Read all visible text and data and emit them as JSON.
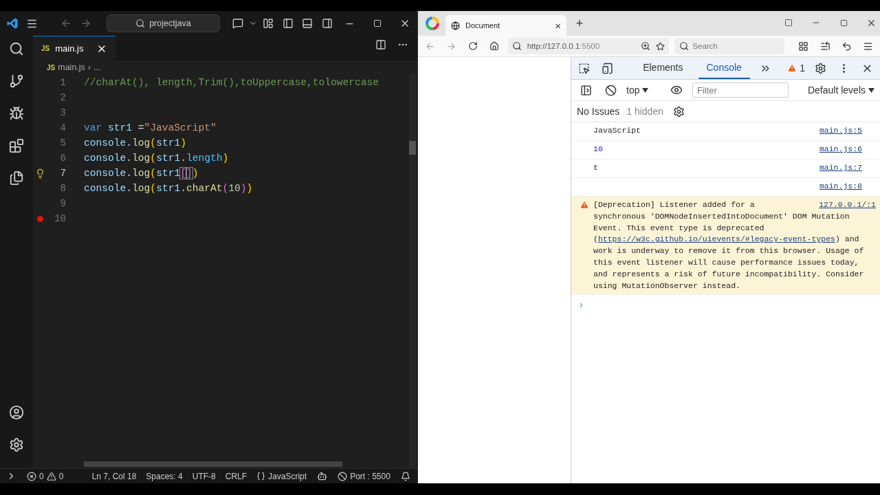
{
  "editor": {
    "command_center": "projectjava",
    "tabs": [
      {
        "label": "main.js",
        "icon": "JS",
        "selected": true
      }
    ],
    "breadcrumb": {
      "icon": "JS",
      "file": "main.js",
      "separator": "›",
      "rest": "..."
    },
    "lines": [
      {
        "number": "1",
        "current": false,
        "tokens": [
          {
            "kind": "comment",
            "text": "//charAt(), length,Trim(),toUppercase,tolowercase"
          }
        ]
      },
      {
        "number": "2",
        "current": false
      },
      {
        "number": "3",
        "current": false
      },
      {
        "number": "4",
        "current": false,
        "tokens": [
          {
            "kind": "keyword",
            "text": "var "
          },
          {
            "kind": "variable",
            "text": "str1"
          },
          {
            "kind": "plain",
            "text": " ="
          },
          {
            "kind": "string",
            "text": "\"JavaScript\""
          }
        ]
      },
      {
        "number": "5",
        "current": false,
        "tokens": [
          {
            "kind": "variable",
            "text": "console"
          },
          {
            "kind": "plain",
            "text": "."
          },
          {
            "kind": "function",
            "text": "log"
          },
          {
            "kind": "bracket",
            "text": "("
          },
          {
            "kind": "variable",
            "text": "str1"
          },
          {
            "kind": "bracket",
            "text": ")"
          }
        ]
      },
      {
        "number": "6",
        "current": false,
        "tokens": [
          {
            "kind": "variable",
            "text": "console"
          },
          {
            "kind": "plain",
            "text": "."
          },
          {
            "kind": "function",
            "text": "log"
          },
          {
            "kind": "bracket",
            "text": "("
          },
          {
            "kind": "variable",
            "text": "str1"
          },
          {
            "kind": "plain",
            "text": "."
          },
          {
            "kind": "property",
            "text": "length"
          },
          {
            "kind": "bracket",
            "text": ")"
          }
        ]
      },
      {
        "number": "7",
        "current": true,
        "lightbulb": true,
        "tokens": [
          {
            "kind": "variable",
            "text": "console"
          },
          {
            "kind": "plain",
            "text": "."
          },
          {
            "kind": "function",
            "text": "log"
          },
          {
            "kind": "bracket",
            "text": "("
          },
          {
            "kind": "variable",
            "text": "str1"
          },
          {
            "kind": "matched-bracket",
            "text": "["
          },
          {
            "kind": "matched-bracket",
            "text": "]"
          },
          {
            "kind": "bracket",
            "text": ")"
          }
        ]
      },
      {
        "number": "8",
        "current": false,
        "tokens": [
          {
            "kind": "variable",
            "text": "console"
          },
          {
            "kind": "plain",
            "text": "."
          },
          {
            "kind": "function",
            "text": "log"
          },
          {
            "kind": "bracket",
            "text": "("
          },
          {
            "kind": "variable",
            "text": "str1"
          },
          {
            "kind": "plain",
            "text": "."
          },
          {
            "kind": "function",
            "text": "charAt"
          },
          {
            "kind": "inner-bracket",
            "text": "("
          },
          {
            "kind": "number",
            "text": "10"
          },
          {
            "kind": "inner-bracket",
            "text": ")"
          },
          {
            "kind": "bracket",
            "text": ")"
          }
        ]
      },
      {
        "number": "9",
        "current": false
      },
      {
        "number": "10",
        "current": false,
        "breakpoint": true
      }
    ]
  },
  "status_bar": {
    "errors": "0",
    "warnings": "0",
    "items": [
      "Ln 7, Col 18",
      "Spaces: 4",
      "UTF-8",
      "CRLF"
    ],
    "language": "JavaScript",
    "port": "Port : 5500"
  },
  "browser": {
    "tab": {
      "title": "Document",
      "close": "×"
    },
    "new_tab": "+",
    "url": {
      "host": "http://127.0.0.1",
      "port": ":5500"
    },
    "search": {
      "placeholder": "Search"
    },
    "devtools": {
      "tabs": [
        {
          "label": "Elements",
          "selected": false
        },
        {
          "label": "Console",
          "selected": true
        }
      ],
      "warning_count": "1",
      "context": "top",
      "filter": {
        "placeholder": "Filter"
      },
      "levels": "Default levels",
      "issues": "No Issues",
      "hidden": "1 hidden",
      "messages": [
        {
          "kind": "log",
          "text": "JavaScript",
          "source": "main.js:5"
        },
        {
          "kind": "number",
          "text": "10",
          "source": "main.js:6"
        },
        {
          "kind": "log",
          "text": "t",
          "source": "main.js:7"
        },
        {
          "kind": "log",
          "source": "main.js:8"
        },
        {
          "kind": "warning",
          "text": "[Deprecation] Listener added for a",
          "text_continued": "synchronous 'DOMNodeInsertedIntoDocument' DOM Mutation Event. This event type is deprecated (",
          "link": "https://w3c.github.io/uievents/#legacy-event-types",
          "text_after": ") and work is underway to remove it from this browser. Usage of this event listener will cause performance issues today, and represents a risk of future incompatibility. Consider using MutationObserver instead.",
          "source": "127.0.0.1/:1"
        }
      ],
      "prompt": "›"
    }
  }
}
